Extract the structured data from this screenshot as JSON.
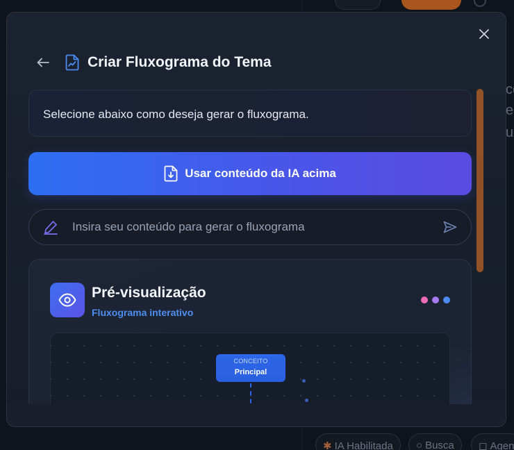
{
  "background": {
    "frag_lines": [
      "co",
      "es",
      "u"
    ],
    "bottom_pills": [
      {
        "label": "IA Habilitada",
        "icon": "sparkle-icon"
      },
      {
        "label": "Busca",
        "icon": "search-icon"
      },
      {
        "label": "Agen",
        "icon": "bag-icon"
      }
    ]
  },
  "modal": {
    "title": "Criar Fluxograma do Tema",
    "info_text": "Selecione abaixo como deseja gerar o fluxograma.",
    "ia_button_label": "Usar conteúdo da IA acima",
    "input_placeholder": "Insira seu conteúdo para gerar o fluxograma",
    "input_value": "",
    "preview": {
      "title": "Pré-visualização",
      "subtitle": "Fluxograma interativo",
      "dots": [
        "#ec6bb8",
        "#a778f0",
        "#4b8cf0"
      ],
      "node_tag": "CONCEITO",
      "node_label": "Principal"
    }
  },
  "colors": {
    "accent": "#3f6ff0",
    "scrollbar": "#a85a26"
  }
}
